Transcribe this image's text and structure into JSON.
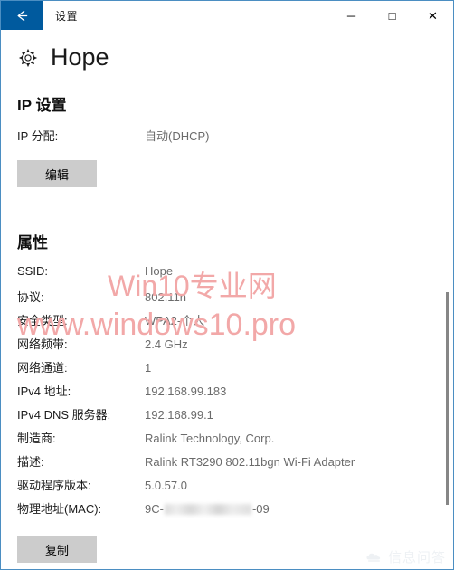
{
  "window": {
    "title": "设置",
    "back_icon": "back-arrow-icon",
    "controls": {
      "minimize": "─",
      "maximize": "□",
      "close": "✕"
    }
  },
  "page": {
    "icon": "gear-icon",
    "title": "Hope"
  },
  "ip_settings": {
    "heading": "IP 设置",
    "rows": [
      {
        "label": "IP 分配:",
        "value": "自动(DHCP)"
      }
    ],
    "edit_button": "编辑"
  },
  "properties": {
    "heading": "属性",
    "rows": [
      {
        "label": "SSID:",
        "value": "Hope"
      },
      {
        "label": "协议:",
        "value": "802.11n"
      },
      {
        "label": "安全类型:",
        "value": "WPA2-个人"
      },
      {
        "label": "网络频带:",
        "value": "2.4 GHz"
      },
      {
        "label": "网络通道:",
        "value": "1"
      },
      {
        "label": "IPv4 地址:",
        "value": "192.168.99.183"
      },
      {
        "label": "IPv4 DNS 服务器:",
        "value": "192.168.99.1"
      },
      {
        "label": "制造商:",
        "value": "Ralink Technology, Corp."
      },
      {
        "label": "描述:",
        "value": "Ralink RT3290 802.11bgn Wi-Fi Adapter"
      },
      {
        "label": "驱动程序版本:",
        "value": "5.0.57.0"
      }
    ],
    "mac_row": {
      "label": "物理地址(MAC):",
      "value_prefix": "9C-",
      "value_suffix": "-09",
      "redacted": true
    },
    "copy_button": "复制"
  },
  "watermarks": {
    "red_line1": "Win10专业网",
    "red_line2": "www.windows10.pro",
    "red_color": "#f2a8a8",
    "gray_text": "信息问答",
    "gray_icon": "cloud-logo-icon"
  },
  "colors": {
    "accent": "#005a9e",
    "window_border": "#4b8ec2",
    "button_bg": "#cccccc",
    "value_text": "#6b6b6b",
    "label_text": "#1c1c1c",
    "scrollbar": "#868686"
  }
}
